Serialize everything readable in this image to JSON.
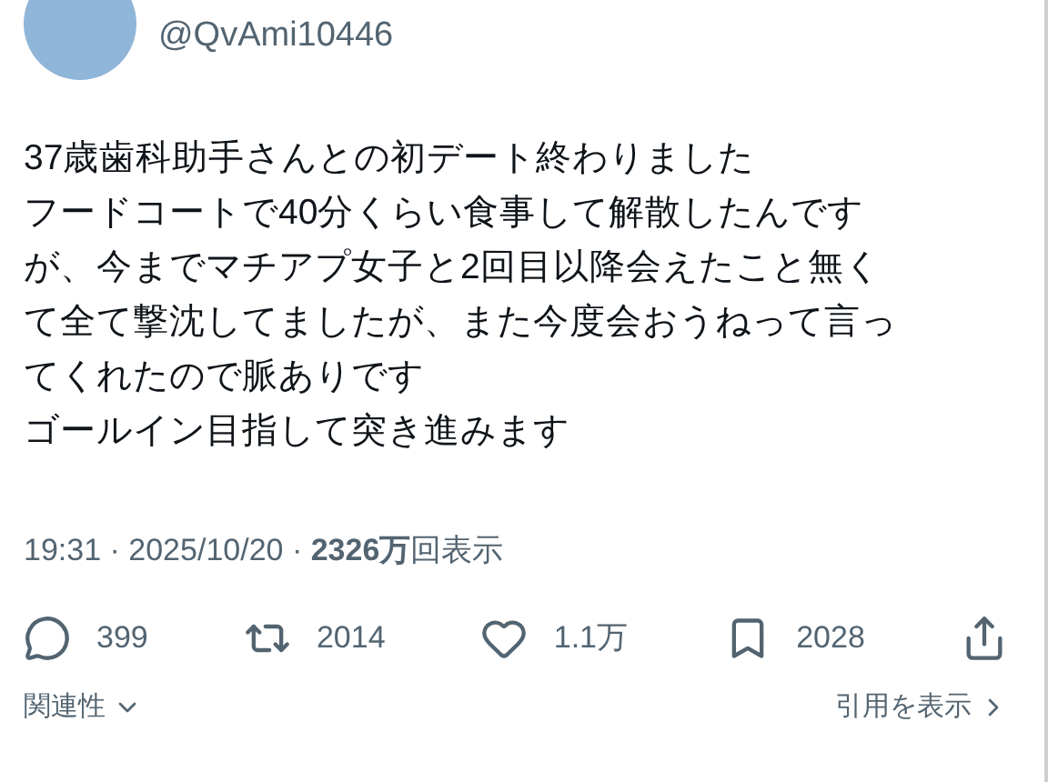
{
  "author": {
    "handle": "@QvAmi10446"
  },
  "post": {
    "lines": [
      "37歳歯科助手さんとの初デート終わりました",
      "フードコートで40分くらい食事して解散したんです",
      "が、今までマチアプ女子と2回目以降会えたこと無く",
      "て全て撃沈してましたが、また今度会おうねって言っ",
      "てくれたので脈ありです",
      "ゴールイン目指して突き進みます"
    ]
  },
  "meta": "19:31 · 2025/10/20 · **2326万**回表示",
  "actions": [
    {
      "kind": "reply",
      "count": "399"
    },
    {
      "kind": "repost",
      "count": "2014"
    },
    {
      "kind": "like",
      "count": "1.1万"
    },
    {
      "kind": "bookmark",
      "count": "2028"
    },
    {
      "kind": "share"
    }
  ],
  "footer": {
    "sort": "関連性",
    "quotes": "引用を表示"
  }
}
